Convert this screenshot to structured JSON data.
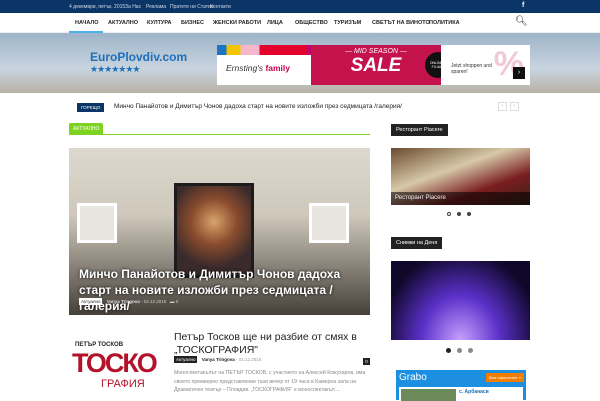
{
  "topbar": {
    "date": "4 декември, петък, 2015",
    "links": [
      "За Нас",
      "Реклама",
      "Пратете ни Статия",
      "Контакти"
    ],
    "social": "f"
  },
  "nav": {
    "items": [
      "НАЧАЛО",
      "АКТУАЛНО",
      "КУЛТУРА",
      "БИЗНЕС",
      "ЖЕНСКИ РАБОТИ",
      "ЛИЦА",
      "ОБЩЕСТВО",
      "ТУРИЗЪМ",
      "СВЕТЪТ НА ВИНОТО",
      "ПОЛИТИКА"
    ],
    "search_icon": "search-icon"
  },
  "header": {
    "logo": "EuroPlovdiv.com",
    "stars": "★★★★★★★"
  },
  "ad": {
    "brand": "Ernsting's",
    "brand_bold": "family",
    "mid": "— MID SEASON —",
    "sale": "SALE",
    "badge": "ONLINE & FILIALE",
    "cta": "Jetzt shoppen und sparen!",
    "pct": "%",
    "arrow": "›"
  },
  "ticker": {
    "label": "ГОРЕЩО",
    "text": "Минчо Панайотов и Димитър Чонов дадоха старт на новите изложби през седмицата /галерия/",
    "prev": "‹",
    "next": "›"
  },
  "section": {
    "label": "АКТУАЛНО"
  },
  "hero": {
    "title": "Минчо Панайотов и Димитър Чонов дадоха старт на новите изложби през седмицата /галерия/",
    "category": "Актуално",
    "author": "Vanya Tringova",
    "date": "02.12.2015",
    "comments": "0"
  },
  "article2": {
    "thumb_name": "ПЕТЪР ТОСКОВ",
    "thumb_big": "ТОСКО",
    "thumb_sub": "ГРАФИЯ",
    "title": "Петър Тосков ще ни разбие от смях в „ТОСКОГРАФИЯ\"",
    "category": "Актуално",
    "author": "Vanya Tringova",
    "date": "01.12.2015",
    "comments": "0",
    "excerpt": "Моноспектакълът на ПЕТЪР ТОСКОВ, с участието на Алексей Кожухаров, има своето премиерно представление тази вечер от 19 часа в Камерна зала на Драматичен театър – Пловдив. „ТОСКОГРАФИЯ“ е моноспектакъл ..."
  },
  "sidebar": {
    "widget1": {
      "title": "Ресторант Piacere",
      "caption": "Ресторант Piacere"
    },
    "widget2": {
      "title": "Снимки на Деня"
    },
    "grabo": {
      "logo": "Grabo",
      "button": "Виж оферитате »",
      "location": "с. Арбанаси"
    }
  }
}
